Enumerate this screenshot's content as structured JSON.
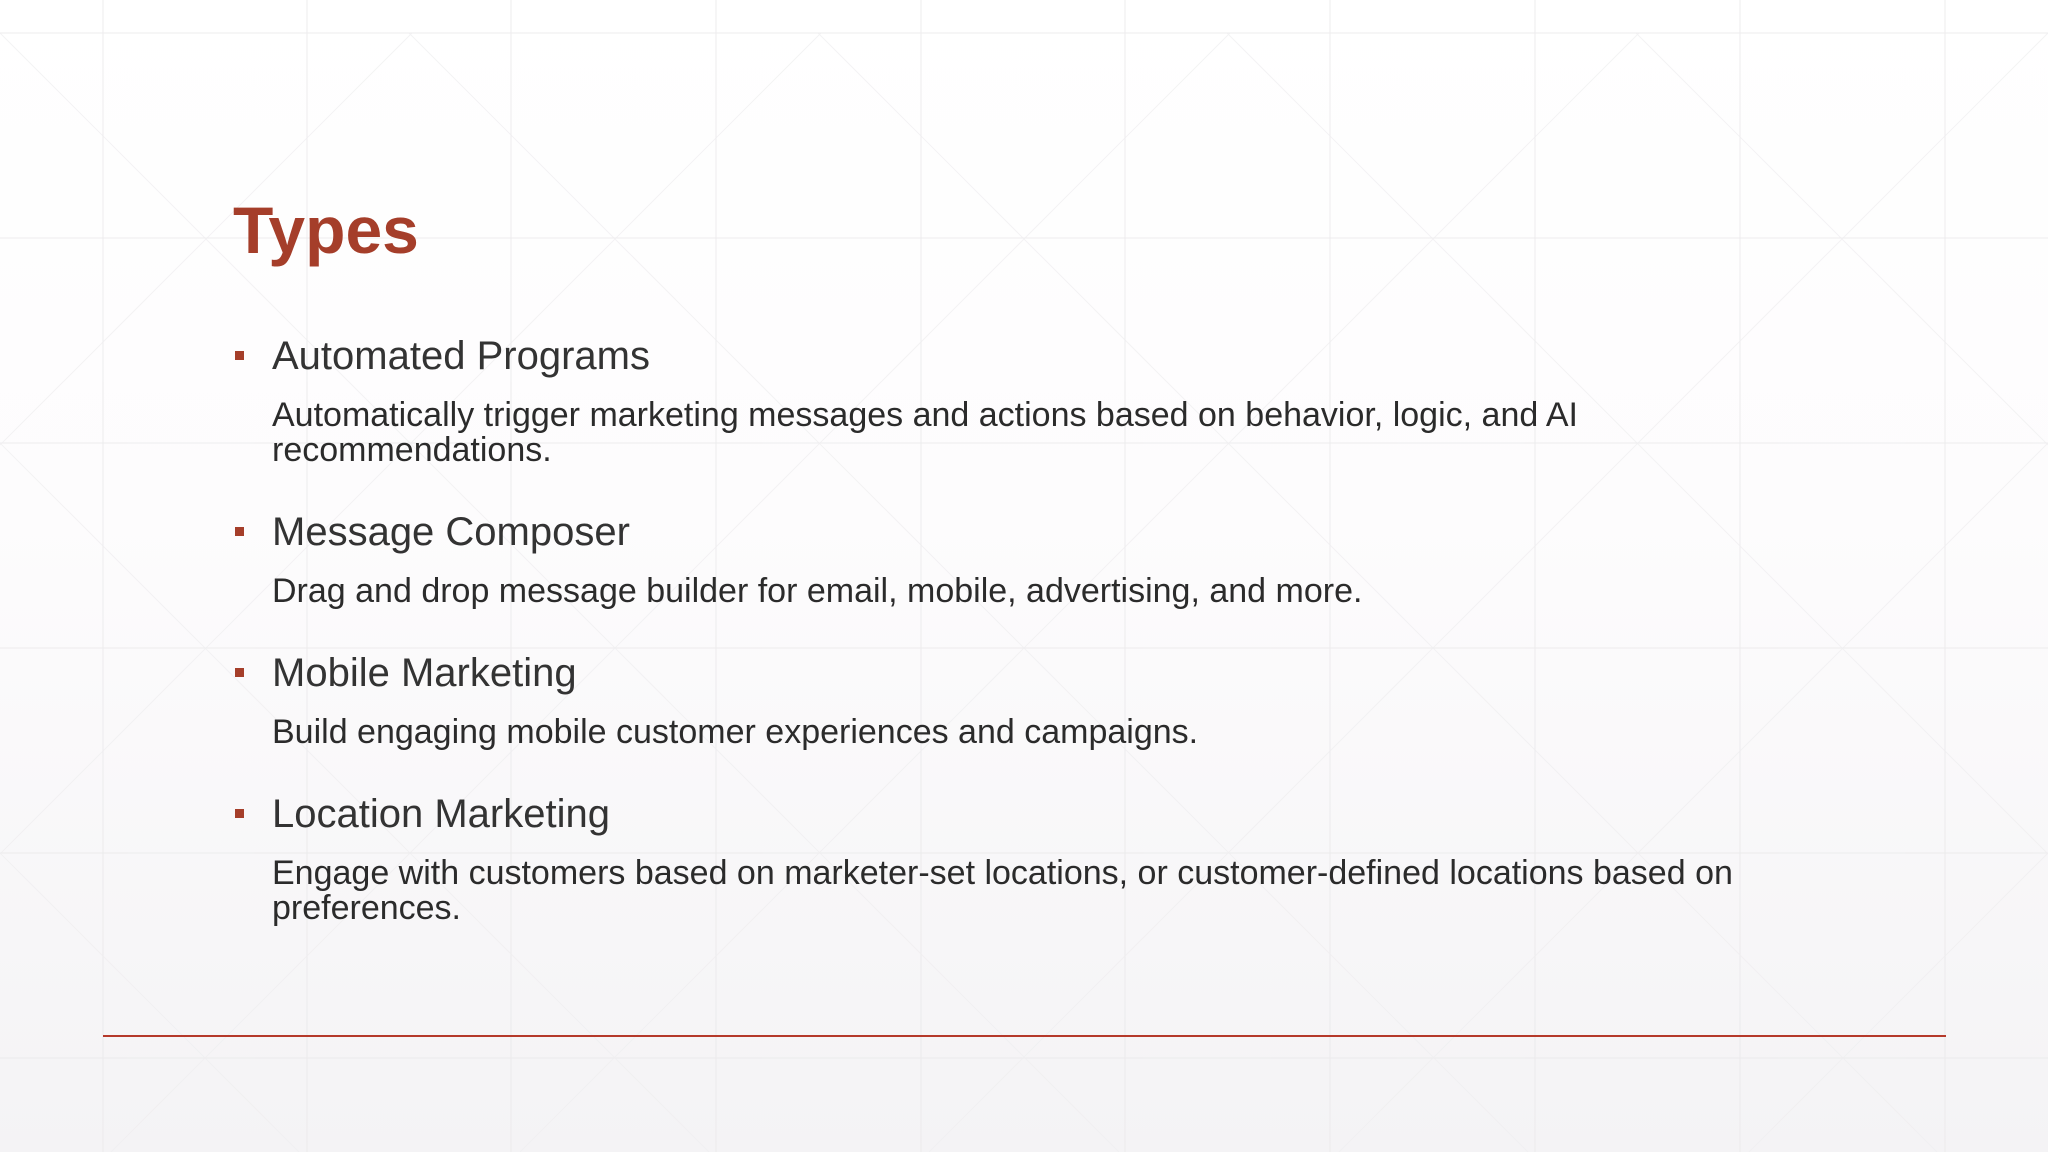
{
  "slide": {
    "title": "Types",
    "items": [
      {
        "heading": "Automated Programs",
        "description": "Automatically trigger marketing messages and actions based on behavior, logic, and AI recommendations."
      },
      {
        "heading": "Message Composer",
        "description": "Drag and drop message builder for email, mobile, advertising, and more."
      },
      {
        "heading": "Mobile Marketing",
        "description": "Build engaging mobile customer experiences and campaigns."
      },
      {
        "heading": "Location Marketing",
        "description": "Engage with customers based on marketer-set locations, or customer-defined locations based on preferences."
      }
    ]
  },
  "colors": {
    "accent": "#a53e2a",
    "text": "#333333",
    "rule": "#b5392a"
  }
}
